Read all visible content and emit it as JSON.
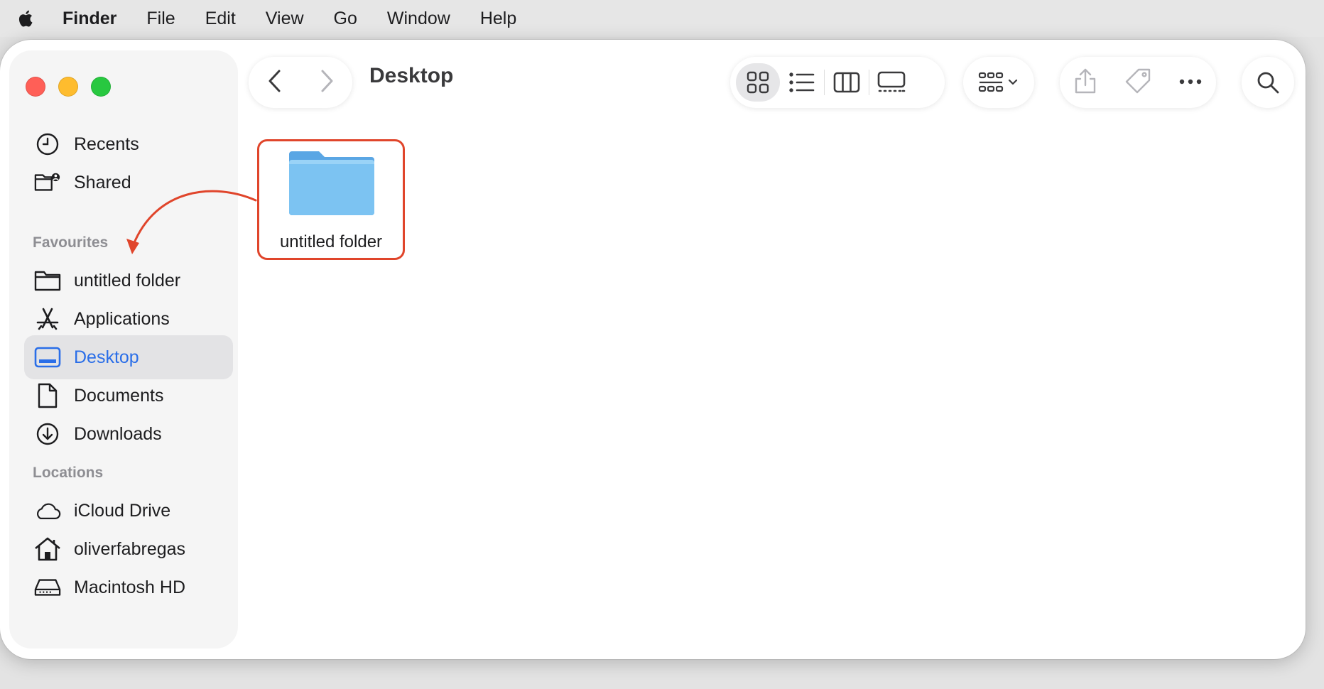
{
  "menubar": {
    "items": [
      "Finder",
      "File",
      "Edit",
      "View",
      "Go",
      "Window",
      "Help"
    ]
  },
  "window": {
    "title": "Desktop"
  },
  "sidebar": {
    "sections": {
      "favourites": "Favourites",
      "locations": "Locations"
    },
    "top_items": [
      {
        "label": "Recents",
        "icon": "clock-icon"
      },
      {
        "label": "Shared",
        "icon": "shared-folder-icon"
      }
    ],
    "favourites": [
      {
        "label": "untitled folder",
        "icon": "folder-icon"
      },
      {
        "label": "Applications",
        "icon": "applications-icon"
      },
      {
        "label": "Desktop",
        "icon": "desktop-icon",
        "selected": true
      },
      {
        "label": "Documents",
        "icon": "document-icon"
      },
      {
        "label": "Downloads",
        "icon": "download-icon"
      }
    ],
    "locations": [
      {
        "label": "iCloud Drive",
        "icon": "cloud-icon"
      },
      {
        "label": "oliverfabregas",
        "icon": "home-icon"
      },
      {
        "label": "Macintosh HD",
        "icon": "disk-icon"
      }
    ]
  },
  "content": {
    "items": [
      {
        "label": "untitled folder",
        "type": "folder"
      }
    ]
  },
  "colors": {
    "accent": "#2a6ee8",
    "annotation": "#e0452b",
    "folder": "#6fb8ee"
  }
}
